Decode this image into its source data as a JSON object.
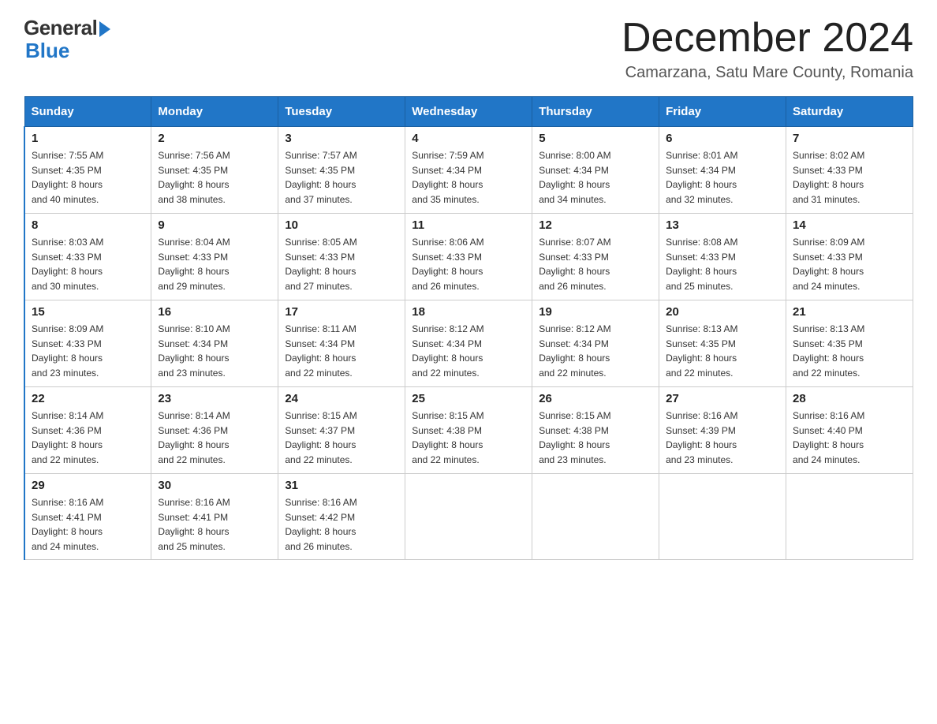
{
  "logo": {
    "general": "General",
    "blue": "Blue"
  },
  "header": {
    "month_year": "December 2024",
    "location": "Camarzana, Satu Mare County, Romania"
  },
  "days_of_week": [
    "Sunday",
    "Monday",
    "Tuesday",
    "Wednesday",
    "Thursday",
    "Friday",
    "Saturday"
  ],
  "weeks": [
    [
      {
        "day": "1",
        "sunrise": "7:55 AM",
        "sunset": "4:35 PM",
        "daylight": "8 hours and 40 minutes."
      },
      {
        "day": "2",
        "sunrise": "7:56 AM",
        "sunset": "4:35 PM",
        "daylight": "8 hours and 38 minutes."
      },
      {
        "day": "3",
        "sunrise": "7:57 AM",
        "sunset": "4:35 PM",
        "daylight": "8 hours and 37 minutes."
      },
      {
        "day": "4",
        "sunrise": "7:59 AM",
        "sunset": "4:34 PM",
        "daylight": "8 hours and 35 minutes."
      },
      {
        "day": "5",
        "sunrise": "8:00 AM",
        "sunset": "4:34 PM",
        "daylight": "8 hours and 34 minutes."
      },
      {
        "day": "6",
        "sunrise": "8:01 AM",
        "sunset": "4:34 PM",
        "daylight": "8 hours and 32 minutes."
      },
      {
        "day": "7",
        "sunrise": "8:02 AM",
        "sunset": "4:33 PM",
        "daylight": "8 hours and 31 minutes."
      }
    ],
    [
      {
        "day": "8",
        "sunrise": "8:03 AM",
        "sunset": "4:33 PM",
        "daylight": "8 hours and 30 minutes."
      },
      {
        "day": "9",
        "sunrise": "8:04 AM",
        "sunset": "4:33 PM",
        "daylight": "8 hours and 29 minutes."
      },
      {
        "day": "10",
        "sunrise": "8:05 AM",
        "sunset": "4:33 PM",
        "daylight": "8 hours and 27 minutes."
      },
      {
        "day": "11",
        "sunrise": "8:06 AM",
        "sunset": "4:33 PM",
        "daylight": "8 hours and 26 minutes."
      },
      {
        "day": "12",
        "sunrise": "8:07 AM",
        "sunset": "4:33 PM",
        "daylight": "8 hours and 26 minutes."
      },
      {
        "day": "13",
        "sunrise": "8:08 AM",
        "sunset": "4:33 PM",
        "daylight": "8 hours and 25 minutes."
      },
      {
        "day": "14",
        "sunrise": "8:09 AM",
        "sunset": "4:33 PM",
        "daylight": "8 hours and 24 minutes."
      }
    ],
    [
      {
        "day": "15",
        "sunrise": "8:09 AM",
        "sunset": "4:33 PM",
        "daylight": "8 hours and 23 minutes."
      },
      {
        "day": "16",
        "sunrise": "8:10 AM",
        "sunset": "4:34 PM",
        "daylight": "8 hours and 23 minutes."
      },
      {
        "day": "17",
        "sunrise": "8:11 AM",
        "sunset": "4:34 PM",
        "daylight": "8 hours and 22 minutes."
      },
      {
        "day": "18",
        "sunrise": "8:12 AM",
        "sunset": "4:34 PM",
        "daylight": "8 hours and 22 minutes."
      },
      {
        "day": "19",
        "sunrise": "8:12 AM",
        "sunset": "4:34 PM",
        "daylight": "8 hours and 22 minutes."
      },
      {
        "day": "20",
        "sunrise": "8:13 AM",
        "sunset": "4:35 PM",
        "daylight": "8 hours and 22 minutes."
      },
      {
        "day": "21",
        "sunrise": "8:13 AM",
        "sunset": "4:35 PM",
        "daylight": "8 hours and 22 minutes."
      }
    ],
    [
      {
        "day": "22",
        "sunrise": "8:14 AM",
        "sunset": "4:36 PM",
        "daylight": "8 hours and 22 minutes."
      },
      {
        "day": "23",
        "sunrise": "8:14 AM",
        "sunset": "4:36 PM",
        "daylight": "8 hours and 22 minutes."
      },
      {
        "day": "24",
        "sunrise": "8:15 AM",
        "sunset": "4:37 PM",
        "daylight": "8 hours and 22 minutes."
      },
      {
        "day": "25",
        "sunrise": "8:15 AM",
        "sunset": "4:38 PM",
        "daylight": "8 hours and 22 minutes."
      },
      {
        "day": "26",
        "sunrise": "8:15 AM",
        "sunset": "4:38 PM",
        "daylight": "8 hours and 23 minutes."
      },
      {
        "day": "27",
        "sunrise": "8:16 AM",
        "sunset": "4:39 PM",
        "daylight": "8 hours and 23 minutes."
      },
      {
        "day": "28",
        "sunrise": "8:16 AM",
        "sunset": "4:40 PM",
        "daylight": "8 hours and 24 minutes."
      }
    ],
    [
      {
        "day": "29",
        "sunrise": "8:16 AM",
        "sunset": "4:41 PM",
        "daylight": "8 hours and 24 minutes."
      },
      {
        "day": "30",
        "sunrise": "8:16 AM",
        "sunset": "4:41 PM",
        "daylight": "8 hours and 25 minutes."
      },
      {
        "day": "31",
        "sunrise": "8:16 AM",
        "sunset": "4:42 PM",
        "daylight": "8 hours and 26 minutes."
      },
      null,
      null,
      null,
      null
    ]
  ],
  "labels": {
    "sunrise": "Sunrise:",
    "sunset": "Sunset:",
    "daylight": "Daylight:"
  }
}
